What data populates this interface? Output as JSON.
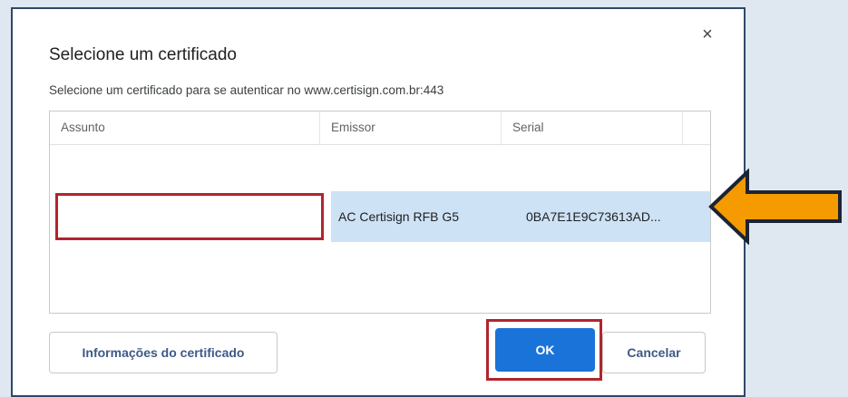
{
  "dialog": {
    "title": "Selecione um certificado",
    "subtitle": "Selecione um certificado para se autenticar no www.certisign.com.br:443",
    "close_label": "×"
  },
  "table": {
    "headers": [
      "Assunto",
      "Emissor",
      "Serial"
    ],
    "rows": [
      {
        "assunto": "",
        "emissor": "AC Certisign RFB G5",
        "serial": "0BA7E1E9C73613AD...",
        "selected": true
      }
    ]
  },
  "buttons": {
    "info": "Informações do certificado",
    "ok": "OK",
    "cancel": "Cancelar"
  },
  "colors": {
    "highlight": "#b0252d",
    "primary": "#1a73d9",
    "selection": "#cde2f5",
    "arrow": "#f59b00",
    "background": "#dfe7f1"
  },
  "icons": {
    "close": "close-icon",
    "pointer_arrow": "left-arrow-icon"
  }
}
